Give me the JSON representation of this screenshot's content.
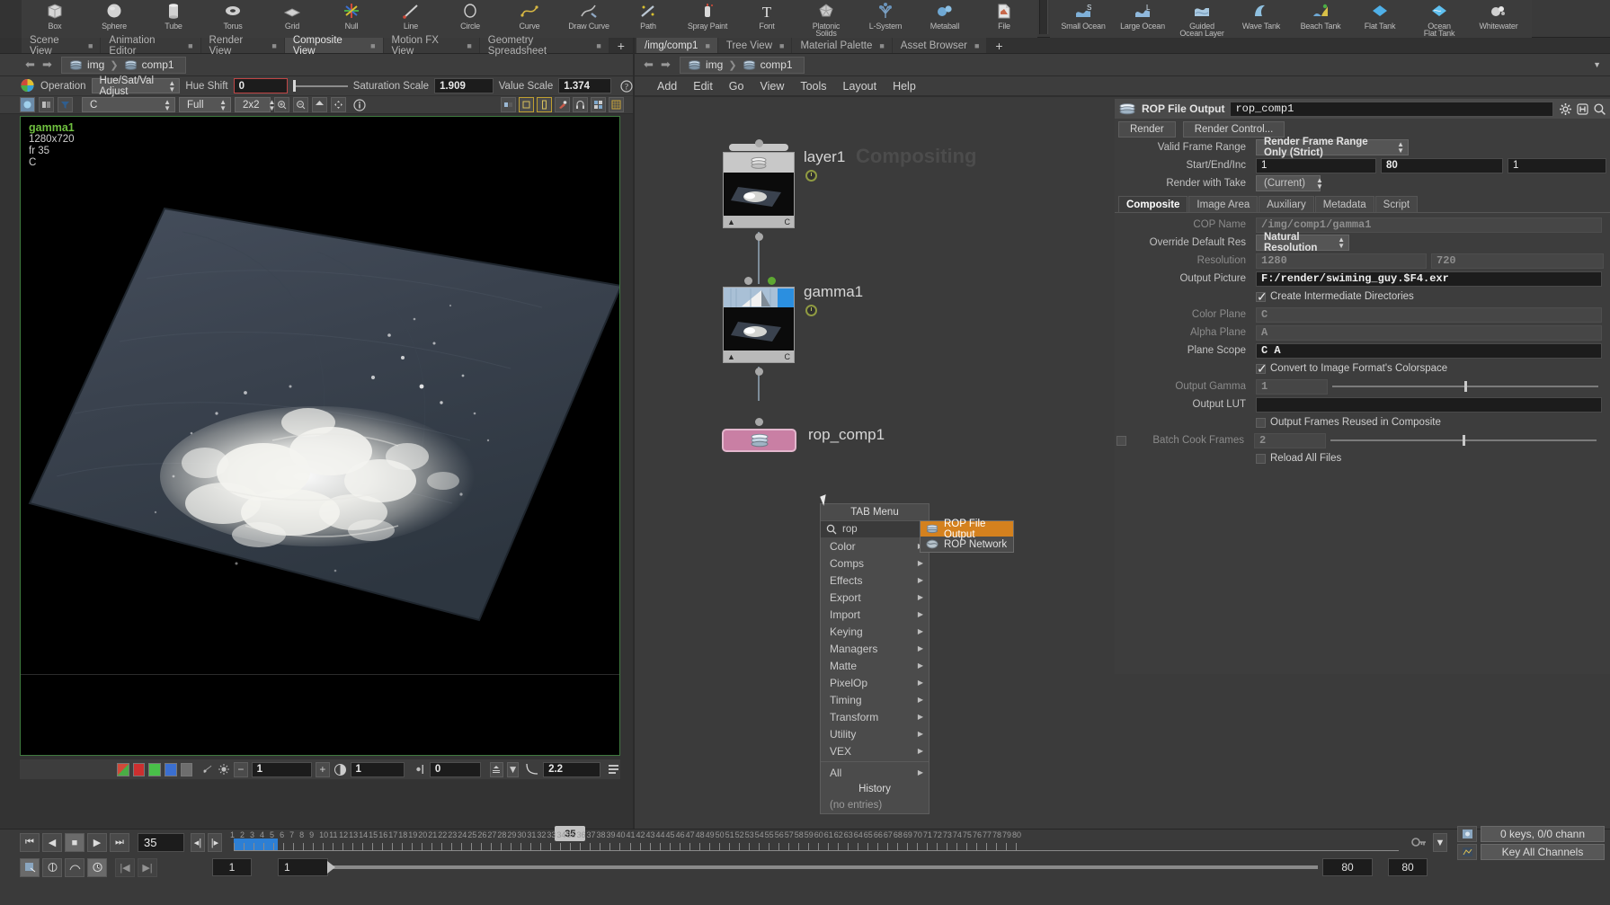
{
  "shelf": {
    "groups": [
      {
        "name": "create",
        "items": [
          {
            "label": "Box",
            "icon": "box-icon"
          },
          {
            "label": "Sphere",
            "icon": "sphere-icon"
          },
          {
            "label": "Tube",
            "icon": "tube-icon"
          },
          {
            "label": "Torus",
            "icon": "torus-icon"
          },
          {
            "label": "Grid",
            "icon": "grid-icon"
          },
          {
            "label": "Null",
            "icon": "null-icon"
          },
          {
            "label": "Line",
            "icon": "line-icon"
          },
          {
            "label": "Circle",
            "icon": "circle-icon"
          },
          {
            "label": "Curve",
            "icon": "curve-icon"
          },
          {
            "label": "Draw Curve",
            "icon": "draw-curve-icon"
          },
          {
            "label": "Path",
            "icon": "path-icon"
          },
          {
            "label": "Spray Paint",
            "icon": "spray-paint-icon"
          },
          {
            "label": "Font",
            "icon": "font-icon"
          },
          {
            "label": "Platonic\nSolids",
            "icon": "platonic-solids-icon"
          },
          {
            "label": "L-System",
            "icon": "lsystem-icon"
          },
          {
            "label": "Metaball",
            "icon": "metaball-icon"
          },
          {
            "label": "File",
            "icon": "file-icon"
          }
        ]
      },
      {
        "name": "ocean",
        "items": [
          {
            "label": "Small Ocean",
            "icon": "small-ocean-icon"
          },
          {
            "label": "Large Ocean",
            "icon": "large-ocean-icon"
          },
          {
            "label": "Guided\nOcean Layer",
            "icon": "guided-ocean-layer-icon"
          },
          {
            "label": "Wave Tank",
            "icon": "wave-tank-icon"
          },
          {
            "label": "Beach Tank",
            "icon": "beach-tank-icon"
          },
          {
            "label": "Flat Tank",
            "icon": "flat-tank-icon"
          },
          {
            "label": "Ocean\nFlat Tank",
            "icon": "ocean-flat-tank-icon"
          },
          {
            "label": "Whitewater",
            "icon": "whitewater-icon"
          }
        ]
      }
    ]
  },
  "left_pane": {
    "tabs": [
      {
        "label": "Scene View",
        "selected": false
      },
      {
        "label": "Animation Editor",
        "selected": false
      },
      {
        "label": "Render View",
        "selected": false
      },
      {
        "label": "Composite View",
        "selected": true
      },
      {
        "label": "Motion FX View",
        "selected": false
      },
      {
        "label": "Geometry Spreadsheet",
        "selected": false
      }
    ],
    "add_tab_label": "+",
    "breadcrumb": [
      {
        "label": "img"
      },
      {
        "label": "comp1"
      }
    ],
    "op_toolbar": {
      "operation_label": "Operation",
      "operation_value": "Hue/Sat/Val Adjust",
      "hue_shift_label": "Hue Shift",
      "hue_shift_value": "0",
      "saturation_label": "Saturation Scale",
      "saturation_value": "1.909",
      "value_scale_label": "Value Scale",
      "value_scale_value": "1.374"
    },
    "display_toolbar": {
      "plane": "C",
      "resolution_mode": "Full",
      "tiling": "2x2"
    },
    "viewport_overlay": {
      "node": "gamma1",
      "resolution": "1280x720",
      "frame": "fr 35",
      "plane": "C"
    },
    "cv_bottom_bar": {
      "zoom_value": "1",
      "gain_value": "1",
      "offset_value": "0",
      "gamma_value": "2.2"
    }
  },
  "network_pane": {
    "tabs": [
      {
        "label": "/img/comp1",
        "selected": true
      },
      {
        "label": "Tree View",
        "selected": false
      },
      {
        "label": "Material Palette",
        "selected": false
      },
      {
        "label": "Asset Browser",
        "selected": false
      }
    ],
    "add_tab_label": "+",
    "breadcrumb": [
      {
        "label": "img"
      },
      {
        "label": "comp1"
      }
    ],
    "menus": [
      "Add",
      "Edit",
      "Go",
      "View",
      "Tools",
      "Layout",
      "Help"
    ],
    "watermark": "Compositing",
    "nodes": [
      {
        "name": "layer1",
        "kind": "layer",
        "flag_char": "C"
      },
      {
        "name": "gamma1",
        "kind": "gamma",
        "flag_char": "C"
      },
      {
        "name": "rop_comp1",
        "kind": "rop",
        "flag_char": ""
      }
    ]
  },
  "tab_menu": {
    "title": "TAB Menu",
    "search_value": "rop",
    "search_icon": "search-icon",
    "categories": [
      "Color",
      "Comps",
      "Effects",
      "Export",
      "Import",
      "Keying",
      "Managers",
      "Matte",
      "PixelOp",
      "Timing",
      "Transform",
      "Utility",
      "VEX"
    ],
    "all_label": "All",
    "history_label": "History",
    "history_empty": "(no entries)",
    "submenu": [
      {
        "label": "ROP File Output",
        "highlighted": true,
        "icon": "rop-file-output-icon"
      },
      {
        "label": "ROP Network",
        "highlighted": false,
        "icon": "rop-network-icon"
      }
    ]
  },
  "param_pane": {
    "node_type": "ROP File Output",
    "node_name": "rop_comp1",
    "buttons": {
      "render": "Render",
      "render_control": "Render Control..."
    },
    "rows": {
      "valid_frame_range_label": "Valid Frame Range",
      "valid_frame_range_value": "Render Frame Range Only (Strict)",
      "start_end_inc_label": "Start/End/Inc",
      "start": "1",
      "end": "80",
      "inc": "1",
      "render_with_take_label": "Render with Take",
      "render_with_take_value": "(Current)"
    },
    "tabs": [
      {
        "label": "Composite",
        "selected": true
      },
      {
        "label": "Image Area",
        "selected": false
      },
      {
        "label": "Auxiliary",
        "selected": false
      },
      {
        "label": "Metadata",
        "selected": false
      },
      {
        "label": "Script",
        "selected": false
      }
    ],
    "composite": {
      "cop_name_label": "COP Name",
      "cop_name_value": "/img/comp1/gamma1",
      "override_res_label": "Override Default Res",
      "override_res_value": "Natural Resolution",
      "resolution_label": "Resolution",
      "resolution_x": "1280",
      "resolution_y": "720",
      "output_picture_label": "Output Picture",
      "output_picture_value": "F:/render/swiming_guy.$F4.exr",
      "create_intermediate_label": "Create Intermediate Directories",
      "create_intermediate_checked": true,
      "color_plane_label": "Color Plane",
      "color_plane_value": "C",
      "alpha_plane_label": "Alpha Plane",
      "alpha_plane_value": "A",
      "plane_scope_label": "Plane Scope",
      "plane_scope_value": "C  A",
      "convert_colorspace_label": "Convert to Image Format's Colorspace",
      "convert_colorspace_checked": true,
      "output_gamma_label": "Output Gamma",
      "output_gamma_value": "1",
      "output_lut_label": "Output LUT",
      "output_lut_value": "",
      "output_frames_reused_label": "Output Frames Reused in Composite",
      "output_frames_reused_checked": false,
      "batch_cook_label": "Batch Cook Frames",
      "batch_cook_value": "2",
      "batch_cook_checked": false,
      "reload_all_label": "Reload All Files",
      "reload_all_checked": false
    }
  },
  "playbar": {
    "current_frame": "35",
    "frame_indicator": "35",
    "range_start": "1",
    "range_start2": "1",
    "range_end": "80",
    "range_end2": "80",
    "keys_status": "0 keys, 0/0 chann",
    "key_all_label": "Key All Channels",
    "ruler_start": 1,
    "ruler_end": 80,
    "ruler_labels": [
      1,
      2,
      3,
      4,
      5,
      6,
      7,
      8,
      9,
      10,
      11,
      12,
      13,
      14,
      15,
      16,
      17,
      18,
      19,
      20,
      21,
      22,
      23,
      24,
      25,
      26,
      27,
      28,
      29,
      30,
      31,
      32,
      33,
      34,
      35,
      36,
      37,
      38,
      39,
      40,
      41,
      42,
      43,
      44,
      45,
      46,
      47,
      48,
      49,
      50,
      51,
      52,
      53,
      54,
      55,
      56,
      57,
      58,
      59,
      60,
      61,
      62,
      63,
      64,
      65,
      66,
      67,
      68,
      69,
      70,
      71,
      72,
      73,
      74,
      75,
      76,
      77,
      78,
      79,
      80
    ]
  }
}
